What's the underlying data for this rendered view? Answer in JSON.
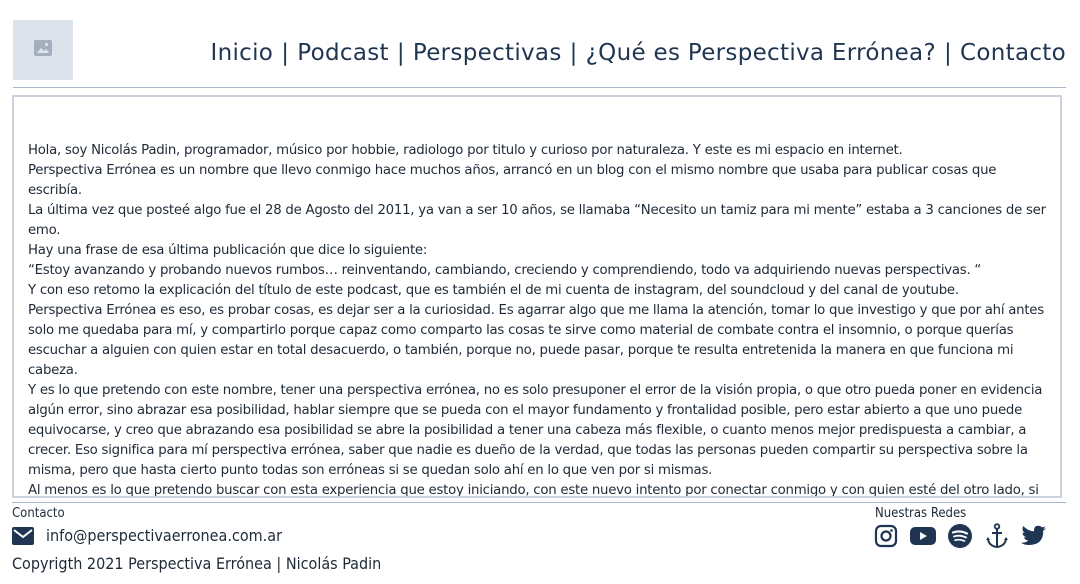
{
  "header": {
    "logo_icon": "image-placeholder-icon",
    "nav": [
      {
        "label": "Inicio"
      },
      {
        "label": "Podcast"
      },
      {
        "label": "Perspectivas"
      },
      {
        "label": "¿Qué es Perspectiva Errónea?"
      },
      {
        "label": "Contacto"
      }
    ],
    "separator": "|"
  },
  "main": {
    "paragraphs": [
      "Hola, soy Nicolás Padin, programador, músico por hobbie, radiologo por titulo y curioso por naturaleza. Y este es mi espacio en internet.",
      "Perspectiva Errónea es un nombre que llevo conmigo hace muchos años, arrancó en un blog con el mismo nombre que usaba para publicar cosas que escribía.",
      "La última vez que posteé algo fue el 28 de Agosto del 2011, ya van a ser 10 años, se llamaba “Necesito un tamiz para mi mente” estaba a 3 canciones de ser emo.",
      "Hay una frase de esa última publicación que dice lo siguiente:",
      "“Estoy avanzando y probando nuevos rumbos… reinventando, cambiando, creciendo y comprendiendo, todo va adquiriendo nuevas perspectivas. “",
      "Y con eso retomo la explicación del título de este podcast, que es también el de mi cuenta de instagram, del soundcloud y del canal de youtube.",
      "Perspectiva Errónea es eso, es probar cosas, es dejar ser a la curiosidad. Es agarrar algo que me llama la atención, tomar lo que investigo y que por ahí antes solo me quedaba para mí, y compartirlo porque capaz como comparto las cosas te sirve como material de combate contra el insomnio, o porque querías escuchar a alguien con quien estar en total desacuerdo, o también, porque no, puede pasar, porque te resulta entretenida la manera en que funciona mi cabeza.",
      "Y es lo que pretendo con este nombre, tener una perspectiva errónea, no es solo presuponer el error de la visión propia, o que otro pueda poner en evidencia algún error, sino abrazar esa posibilidad, hablar siempre que se pueda con el mayor fundamento y frontalidad posible, pero estar abierto a que uno puede equivocarse, y creo que abrazando esa posibilidad se abre la posibilidad a tener una cabeza más flexible, o cuanto menos mejor predispuesta a cambiar, a crecer. Eso significa para mí perspectiva errónea, saber que nadie es dueño de la verdad, que todas las personas pueden compartir su perspectiva sobre la misma, pero que hasta cierto punto todas son erróneas si se quedan solo ahí en lo que ven por si mismas.",
      "Al menos es lo que pretendo buscar con esta experiencia que estoy iniciando, con este nuevo intento por conectar conmigo y con quien esté del otro lado, si sabrá mi psicóloga que me cuesta conectar, jajaja."
    ]
  },
  "footer": {
    "contact_label": "Contacto",
    "email": "info@perspectivaerronea.com.ar",
    "copyright": "Copyrigth 2021 Perspectiva Errónea | Nicolás Padin",
    "social_label": "Nuestras Redes",
    "social_icons": [
      "instagram-icon",
      "youtube-icon",
      "spotify-icon",
      "anchor-icon",
      "twitter-icon"
    ]
  },
  "colors": {
    "text": "#1f3552",
    "border": "#c9d4de",
    "logo_bg": "#dde3ea"
  }
}
